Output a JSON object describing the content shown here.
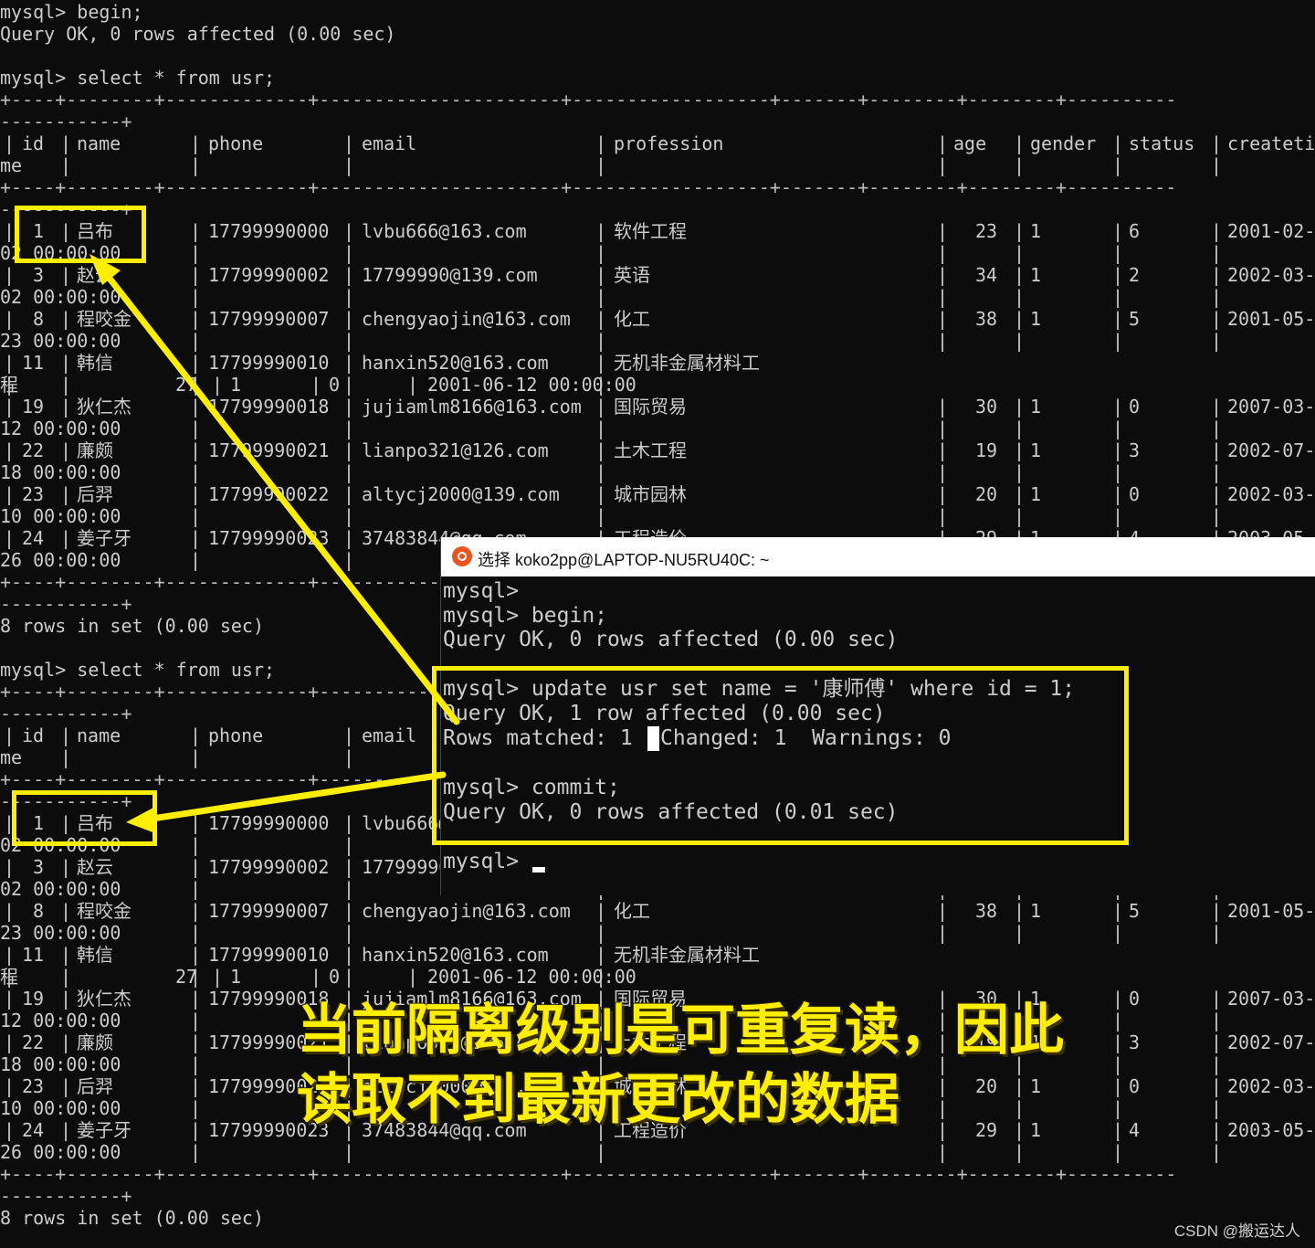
{
  "terminal": {
    "lines_top": {
      "l1": "mysql> begin;",
      "l2": "Query OK, 0 rows affected (0.00 sec)",
      "l3": "mysql> select * from usr;",
      "sep": "+----+--------+-------------+----------------------+------------------+-------+--------+--------+----------",
      "sep_tail": "-----------+",
      "rows_summary": "8 rows in set (0.00 sec)",
      "l_select2": "mysql> select * from usr;"
    },
    "columns": [
      "id",
      "name",
      "phone",
      "email",
      "profession",
      "age",
      "gender",
      "status",
      "createti"
    ],
    "header_wrap": "me",
    "first_result": [
      {
        "id": "1",
        "name": "吕布",
        "phone": "17799990000",
        "email": "lvbu666@163.com",
        "profession": "软件工程",
        "age": "23",
        "gender": "1",
        "status": "6",
        "createtime": "2001-02-",
        "wrap": "02 00:00:00"
      },
      {
        "id": "3",
        "name": "赵云",
        "phone": "17799990002",
        "email": "17799990@139.com",
        "profession": "英语",
        "age": "34",
        "gender": "1",
        "status": "2",
        "createtime": "2002-03-",
        "wrap": "02 00:00:00"
      },
      {
        "id": "8",
        "name": "程咬金",
        "phone": "17799990007",
        "email": "chengyaojin@163.com",
        "profession": "化工",
        "age": "38",
        "gender": "1",
        "status": "5",
        "createtime": "2001-05-",
        "wrap": "23 00:00:00"
      },
      {
        "id": "11",
        "name": "韩信",
        "phone": "17799990010",
        "email": "hanxin520@163.com",
        "profession": "无机非金属材料工",
        "age": "27",
        "gender": "1",
        "status": "0",
        "createtime": "2001-06-12 00:00:00",
        "wrap": "程"
      },
      {
        "id": "19",
        "name": "狄仁杰",
        "phone": "17799990018",
        "email": "jujiamlm8166@163.com",
        "profession": "国际贸易",
        "age": "30",
        "gender": "1",
        "status": "0",
        "createtime": "2007-03-",
        "wrap": "12 00:00:00"
      },
      {
        "id": "22",
        "name": "廉颇",
        "phone": "17799990021",
        "email": "lianpo321@126.com",
        "profession": "土木工程",
        "age": "19",
        "gender": "1",
        "status": "3",
        "createtime": "2002-07-",
        "wrap": "18 00:00:00"
      },
      {
        "id": "23",
        "name": "后羿",
        "phone": "17799990022",
        "email": "altycj2000@139.com",
        "profession": "城市园林",
        "age": "20",
        "gender": "1",
        "status": "0",
        "createtime": "2002-03-",
        "wrap": "10 00:00:00"
      },
      {
        "id": "24",
        "name": "姜子牙",
        "phone": "17799990023",
        "email": "37483844@qq.com",
        "profession": "工程造价",
        "age": "29",
        "gender": "1",
        "status": "4",
        "createtime": "2003-05-",
        "wrap": "26 00:00:00"
      }
    ],
    "second_result_visible": {
      "row1_email_partial": "lvbu666",
      "row2_email_partial": "1779999",
      "row1_wrap_partial": "02 00:00:00"
    }
  },
  "window": {
    "title": "选择 koko2pp@LAPTOP-NU5RU40C: ~",
    "lines": {
      "w1": "mysql>",
      "w2": "mysql> begin;",
      "w3": "Query OK, 0 rows affected (0.00 sec)",
      "w4": "mysql> update usr set name = '康师傅' where id = 1;",
      "w5": "Query OK, 1 row affected (0.00 sec)",
      "w6a": "Rows matched: 1 ",
      "w6b": "Changed: 1  Warnings: 0",
      "w7": "mysql> commit;",
      "w8": "Query OK, 0 rows affected (0.01 sec)",
      "w9": "mysql> "
    }
  },
  "annotation": {
    "caption_line1": "当前隔离级别是可重复读，因此",
    "caption_line2": "读取不到最新更改的数据",
    "color": "#ffee00"
  },
  "watermark": "CSDN @搬运达人"
}
